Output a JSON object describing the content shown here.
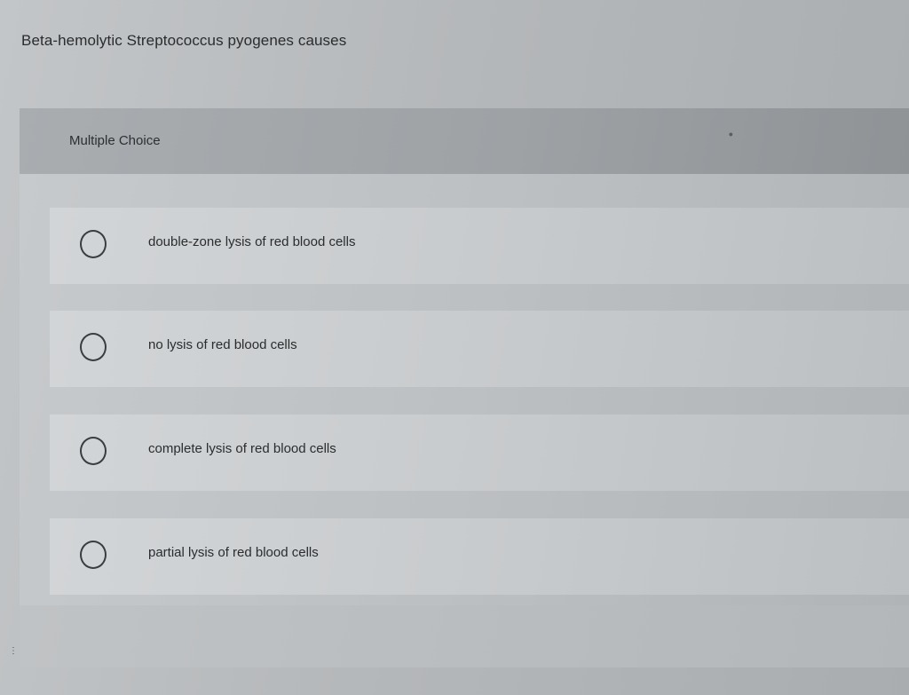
{
  "question": {
    "text": "Beta-hemolytic Streptococcus pyogenes causes"
  },
  "card": {
    "type_label": "Multiple Choice",
    "options": [
      {
        "label": "double-zone lysis of red blood cells",
        "selected": false
      },
      {
        "label": "no lysis of red blood cells",
        "selected": false
      },
      {
        "label": "complete lysis of red blood cells",
        "selected": false
      },
      {
        "label": "partial lysis of red blood cells",
        "selected": false
      }
    ]
  },
  "icons": {
    "radio": "radio-unselected-icon"
  }
}
